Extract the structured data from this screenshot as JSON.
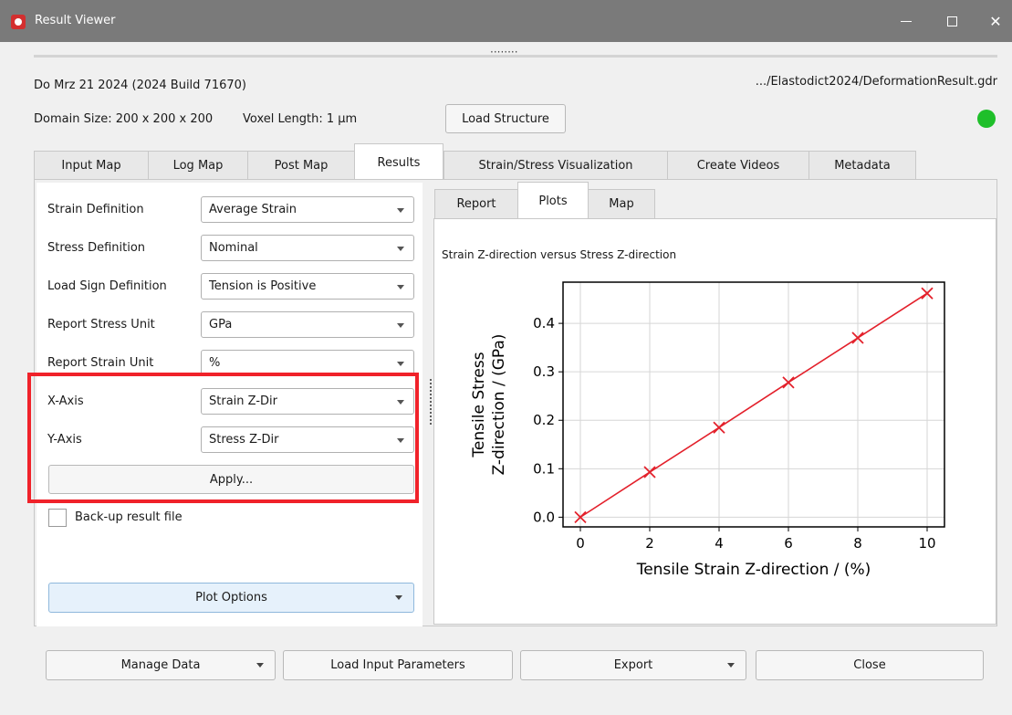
{
  "window": {
    "title": "Result Viewer",
    "icon": "app-logo-icon",
    "buttons": [
      "minimize-icon",
      "maximize-icon",
      "close-icon"
    ]
  },
  "header": {
    "date_build": "Do Mrz 21 2024 (2024 Build 71670)",
    "file_path": ".../Elastodict2024/DeformationResult.gdr",
    "domain_size": "Domain Size: 200 x 200 x 200",
    "voxel_length": "Voxel Length: 1 µm",
    "load_structure_label": "Load Structure",
    "status_color": "#1fbf2a"
  },
  "tabs": [
    {
      "label": "Input Map"
    },
    {
      "label": "Log Map"
    },
    {
      "label": "Post Map"
    },
    {
      "label": "Results",
      "active": true
    },
    {
      "label": "Strain/Stress Visualization"
    },
    {
      "label": "Create Videos"
    },
    {
      "label": "Metadata"
    }
  ],
  "settings": {
    "rows": [
      {
        "label": "Strain Definition",
        "value": "Average Strain"
      },
      {
        "label": "Stress Definition",
        "value": "Nominal"
      },
      {
        "label": "Load Sign Definition",
        "value": "Tension is Positive"
      },
      {
        "label": "Report Stress Unit",
        "value": "GPa"
      },
      {
        "label": "Report Strain Unit",
        "value": "%"
      },
      {
        "label": "X-Axis",
        "value": "Strain Z-Dir"
      },
      {
        "label": "Y-Axis",
        "value": "Stress Z-Dir"
      }
    ],
    "apply_label": "Apply...",
    "backup_label": "Back-up result file",
    "backup_checked": false,
    "plot_options_label": "Plot Options",
    "highlight_color": "#f0222a"
  },
  "result_tabs": [
    {
      "label": "Report"
    },
    {
      "label": "Plots",
      "active": true
    },
    {
      "label": "Map"
    }
  ],
  "chart_data": {
    "type": "line",
    "title": "Strain Z-direction versus Stress Z-direction",
    "xlabel": "Tensile Strain Z-direction / (%)",
    "ylabel_line1": "Tensile Stress",
    "ylabel_line2": "Z-direction / (GPa)",
    "x": [
      0,
      2,
      4,
      6,
      8,
      10
    ],
    "y": [
      0.0,
      0.093,
      0.185,
      0.278,
      0.37,
      0.462
    ],
    "xlim": [
      -0.5,
      10.5
    ],
    "ylim": [
      -0.02,
      0.485
    ],
    "xticks": [
      0,
      2,
      4,
      6,
      8,
      10
    ],
    "yticks": [
      0.0,
      0.1,
      0.2,
      0.3,
      0.4
    ],
    "ytick_labels": [
      "0.0",
      "0.1",
      "0.2",
      "0.3",
      "0.4"
    ],
    "grid": true,
    "marker": "x",
    "color": "#e3202b"
  },
  "footer": {
    "manage_data_label": "Manage Data",
    "load_input_label": "Load Input Parameters",
    "export_label": "Export",
    "close_label": "Close"
  }
}
